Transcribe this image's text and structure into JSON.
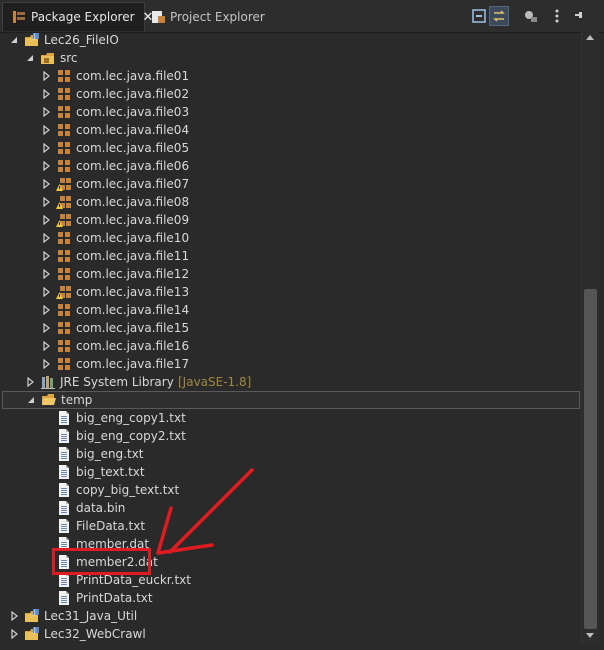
{
  "tabs": [
    {
      "label": "Package Explorer",
      "active": true,
      "close": "✕"
    },
    {
      "label": "Project Explorer",
      "active": false
    }
  ],
  "toolbar": [
    "collapse-all-icon",
    "link-with-editor-icon",
    "filters-icon",
    "view-menu-icon",
    "minimize-icon"
  ],
  "tree": {
    "project": "Lec26_FileIO",
    "src": "src",
    "packages": [
      {
        "name": "com.lec.java.file01",
        "warn": false
      },
      {
        "name": "com.lec.java.file02",
        "warn": false
      },
      {
        "name": "com.lec.java.file03",
        "warn": false
      },
      {
        "name": "com.lec.java.file04",
        "warn": false
      },
      {
        "name": "com.lec.java.file05",
        "warn": false
      },
      {
        "name": "com.lec.java.file06",
        "warn": false
      },
      {
        "name": "com.lec.java.file07",
        "warn": true
      },
      {
        "name": "com.lec.java.file08",
        "warn": true
      },
      {
        "name": "com.lec.java.file09",
        "warn": true
      },
      {
        "name": "com.lec.java.file10",
        "warn": false
      },
      {
        "name": "com.lec.java.file11",
        "warn": false
      },
      {
        "name": "com.lec.java.file12",
        "warn": false
      },
      {
        "name": "com.lec.java.file13",
        "warn": true
      },
      {
        "name": "com.lec.java.file14",
        "warn": false
      },
      {
        "name": "com.lec.java.file15",
        "warn": false
      },
      {
        "name": "com.lec.java.file16",
        "warn": false
      },
      {
        "name": "com.lec.java.file17",
        "warn": false
      }
    ],
    "jre_label": "JRE System Library",
    "jre_version": "[JavaSE-1.8]",
    "temp": "temp",
    "files": [
      "big_eng_copy1.txt",
      "big_eng_copy2.txt",
      "big_eng.txt",
      "big_text.txt",
      "copy_big_text.txt",
      "data.bin",
      "FileData.txt",
      "member.dat",
      "member2.dat",
      "PrintData_euckr.txt",
      "PrintData.txt"
    ],
    "other_projects": [
      "Lec31_Java_Util",
      "Lec32_WebCrawl"
    ]
  },
  "colors": {
    "annotation": "#e11b22",
    "package_icon": "#c8823a",
    "folder_icon": "#e6b84a"
  }
}
